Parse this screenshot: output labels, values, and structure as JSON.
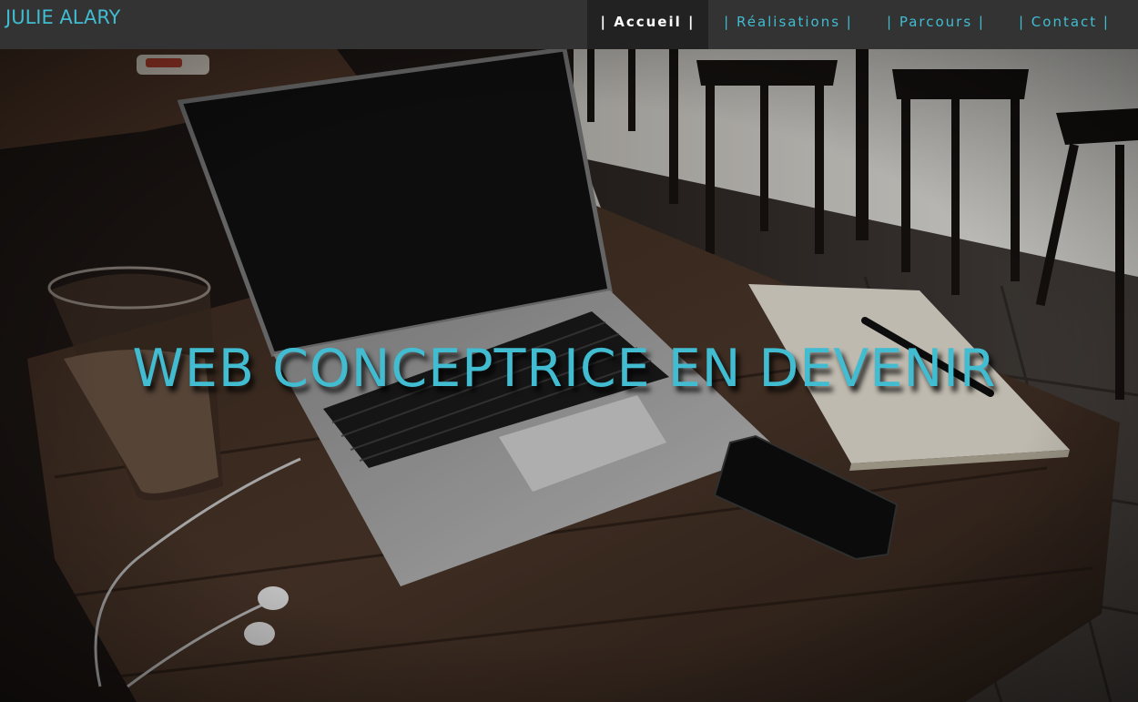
{
  "header": {
    "brand": "JULIE ALARY",
    "nav": [
      {
        "label": "| Accueil |",
        "active": true
      },
      {
        "label": "| Réalisations |",
        "active": false
      },
      {
        "label": "| Parcours |",
        "active": false
      },
      {
        "label": "| Contact |",
        "active": false
      }
    ]
  },
  "hero": {
    "title": "WEB CONCEPTRICE EN DEVENIR",
    "background_description_icon": "laptop-desk-photo"
  },
  "colors": {
    "accent": "#41bcd1",
    "navbar_bg": "#333333",
    "nav_active_bg": "#222222",
    "nav_active_text": "#ffffff"
  }
}
